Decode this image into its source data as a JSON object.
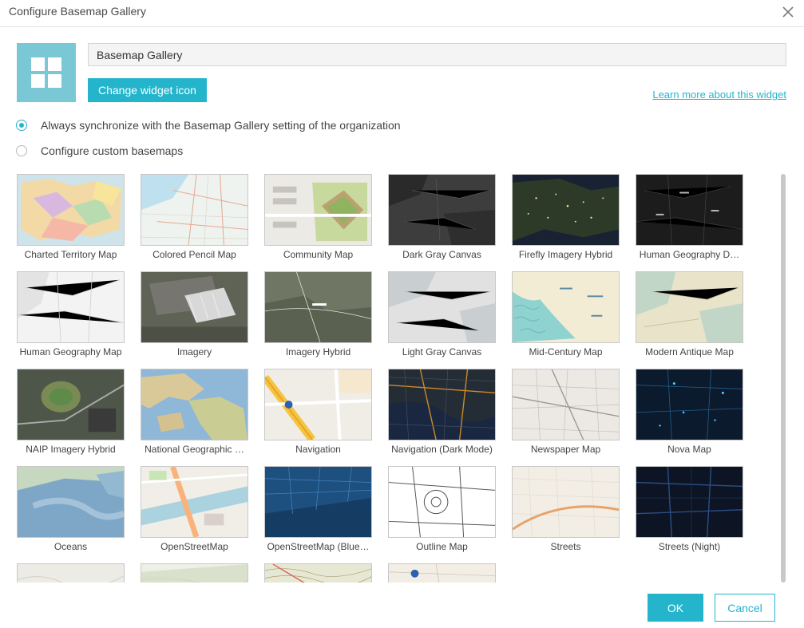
{
  "dialog": {
    "title": "Configure Basemap Gallery",
    "close_icon": "close-icon"
  },
  "widget": {
    "icon": "grid-icon",
    "name_value": "Basemap Gallery",
    "change_icon_label": "Change widget icon",
    "learn_more_label": "Learn more about this widget"
  },
  "options": [
    {
      "label": "Always synchronize with the Basemap Gallery setting of the organization",
      "selected": true
    },
    {
      "label": "Configure custom basemaps",
      "selected": false
    }
  ],
  "basemaps": [
    {
      "label": "Charted Territory Map",
      "theme": "charted"
    },
    {
      "label": "Colored Pencil Map",
      "theme": "pencil"
    },
    {
      "label": "Community Map",
      "theme": "community"
    },
    {
      "label": "Dark Gray Canvas",
      "theme": "darkgray"
    },
    {
      "label": "Firefly Imagery Hybrid",
      "theme": "firefly"
    },
    {
      "label": "Human Geography D…",
      "theme": "humangeodark"
    },
    {
      "label": "Human Geography Map",
      "theme": "humangeo"
    },
    {
      "label": "Imagery",
      "theme": "imagery"
    },
    {
      "label": "Imagery Hybrid",
      "theme": "imageryhybrid"
    },
    {
      "label": "Light Gray Canvas",
      "theme": "lightgray"
    },
    {
      "label": "Mid-Century Map",
      "theme": "midcentury"
    },
    {
      "label": "Modern Antique Map",
      "theme": "antique"
    },
    {
      "label": "NAIP Imagery Hybrid",
      "theme": "naip"
    },
    {
      "label": "National Geographic …",
      "theme": "natgeo"
    },
    {
      "label": "Navigation",
      "theme": "navigation"
    },
    {
      "label": "Navigation (Dark Mode)",
      "theme": "navdark"
    },
    {
      "label": "Newspaper Map",
      "theme": "newspaper"
    },
    {
      "label": "Nova Map",
      "theme": "nova"
    },
    {
      "label": "Oceans",
      "theme": "oceans"
    },
    {
      "label": "OpenStreetMap",
      "theme": "osm"
    },
    {
      "label": "OpenStreetMap (Blue…",
      "theme": "osmblue"
    },
    {
      "label": "Outline Map",
      "theme": "outline"
    },
    {
      "label": "Streets",
      "theme": "streets"
    },
    {
      "label": "Streets (Night)",
      "theme": "streetsnight"
    },
    {
      "label": "",
      "theme": "terrain"
    },
    {
      "label": "",
      "theme": "topo2"
    },
    {
      "label": "",
      "theme": "topo"
    },
    {
      "label": "",
      "theme": "usatopo"
    }
  ],
  "footer": {
    "ok_label": "OK",
    "cancel_label": "Cancel"
  },
  "colors": {
    "accent": "#24b5cc",
    "icon_tile": "#7ac7d5"
  }
}
